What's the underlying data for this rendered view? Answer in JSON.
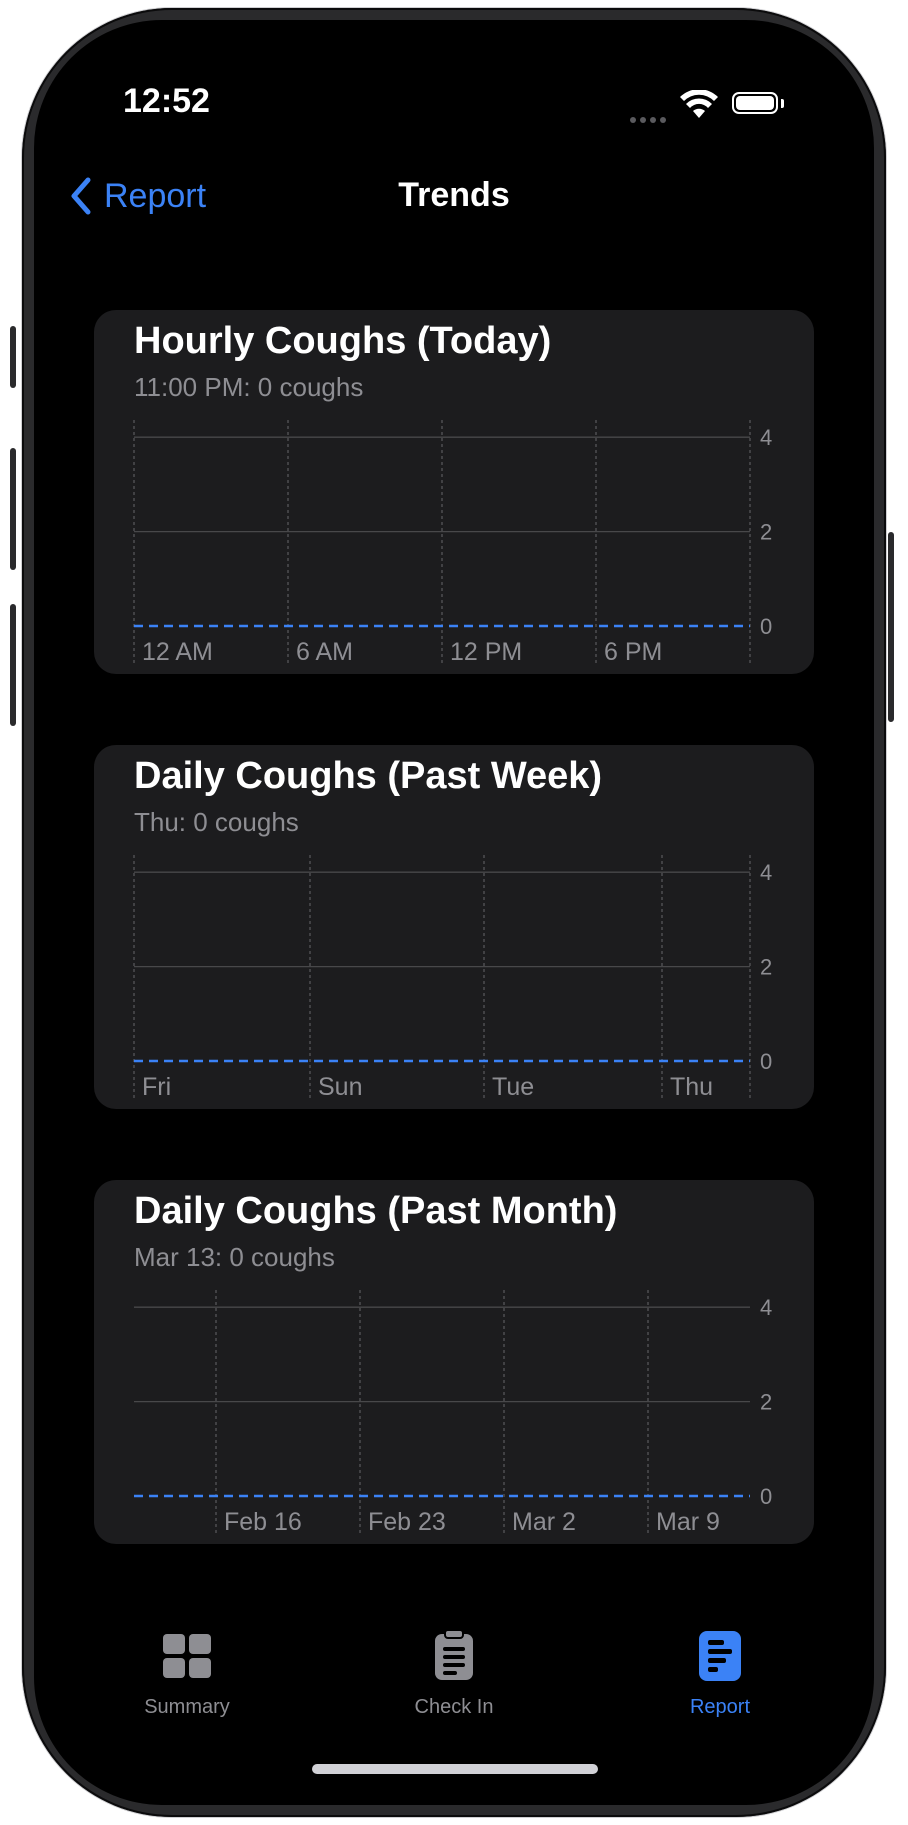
{
  "status_bar": {
    "time": "12:52"
  },
  "nav": {
    "back_label": "Report",
    "title": "Trends"
  },
  "colors": {
    "accent": "#3b82f6",
    "card": "#1c1c1e",
    "secondary_text": "#8e8e93"
  },
  "cards": [
    {
      "title": "Hourly Coughs (Today)",
      "subtitle": "11:00 PM: 0 coughs",
      "chart_data": {
        "type": "line",
        "x_labels": [
          "12 AM",
          "6 AM",
          "12 PM",
          "6 PM"
        ],
        "y_ticks": [
          "0",
          "2",
          "4"
        ],
        "ylim": [
          0,
          5
        ],
        "series": [
          {
            "values": [
              0,
              0,
              0,
              0,
              0
            ]
          }
        ]
      }
    },
    {
      "title": "Daily Coughs (Past Week)",
      "subtitle": "Thu: 0 coughs",
      "chart_data": {
        "type": "line",
        "x_labels": [
          "Fri",
          "Sun",
          "Tue",
          "Thu"
        ],
        "y_ticks": [
          "0",
          "2",
          "4"
        ],
        "ylim": [
          0,
          5
        ],
        "series": [
          {
            "values": [
              0,
              0,
              0,
              0,
              0,
              0,
              0
            ]
          }
        ]
      }
    },
    {
      "title": "Daily Coughs (Past Month)",
      "subtitle": "Mar 13: 0 coughs",
      "chart_data": {
        "type": "line",
        "x_labels": [
          "Feb 16",
          "Feb 23",
          "Mar 2",
          "Mar 9"
        ],
        "y_ticks": [
          "0",
          "2",
          "4"
        ],
        "ylim": [
          0,
          5
        ],
        "series": [
          {
            "values": [
              0,
              0,
              0,
              0,
              0
            ]
          }
        ]
      }
    }
  ],
  "tabbar": {
    "tabs": [
      {
        "label": "Summary",
        "icon": "grid-icon",
        "selected": false
      },
      {
        "label": "Check In",
        "icon": "clipboard-icon",
        "selected": false
      },
      {
        "label": "Report",
        "icon": "report-icon",
        "selected": true
      }
    ]
  }
}
